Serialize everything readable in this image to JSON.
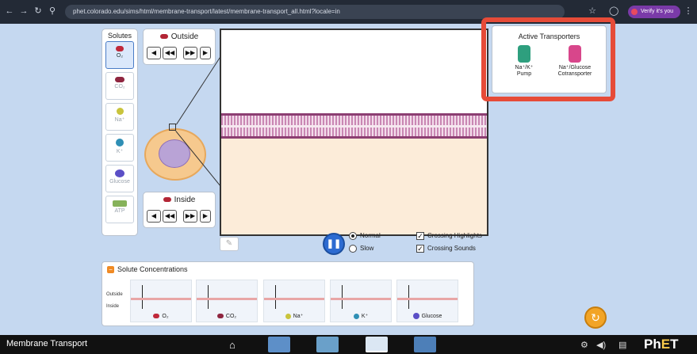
{
  "browser": {
    "url": "phet.colorado.edu/sims/html/membrane-transport/latest/membrane-transport_all.html?locale=in",
    "profile_label": "Verify it's you"
  },
  "solutes": {
    "title": "Solutes",
    "items": [
      {
        "label": "O₂",
        "color": "#c0283a"
      },
      {
        "label": "CO₂",
        "color": "#8f2640"
      },
      {
        "label": "Na⁺",
        "color": "#c9c43c"
      },
      {
        "label": "K⁺",
        "color": "#2f8fb5"
      },
      {
        "label": "Glucose",
        "color": "#5b4fc6"
      },
      {
        "label": "ATP",
        "color": "#86b25a"
      }
    ]
  },
  "outside_controls": {
    "title": "Outside"
  },
  "inside_controls": {
    "title": "Inside"
  },
  "active_transporters": {
    "title": "Active Transporters",
    "items": [
      {
        "label_line1": "Na⁺/K⁺",
        "label_line2": "Pump",
        "color": "#2e9f7e"
      },
      {
        "label_line1": "Na⁺/Glucose",
        "label_line2": "Cotransporter",
        "color": "#d8468b"
      }
    ]
  },
  "speed": {
    "normal": "Normal",
    "slow": "Slow"
  },
  "options": {
    "crossing_highlights": "Crossing Highlights",
    "crossing_sounds": "Crossing Sounds"
  },
  "concentrations": {
    "title": "Solute Concentrations",
    "outside_label": "Outside",
    "inside_label": "Inside",
    "items": [
      {
        "label": "O₂",
        "color": "#c0283a"
      },
      {
        "label": "CO₂",
        "color": "#8f2640"
      },
      {
        "label": "Na⁺",
        "color": "#c9c43c"
      },
      {
        "label": "K⁺",
        "color": "#2f8fb5"
      },
      {
        "label": "Glucose",
        "color": "#5b4fc6"
      }
    ]
  },
  "nav": {
    "title": "Membrane Transport",
    "logo_main": "Ph",
    "logo_e": "E",
    "logo_t": "T"
  }
}
